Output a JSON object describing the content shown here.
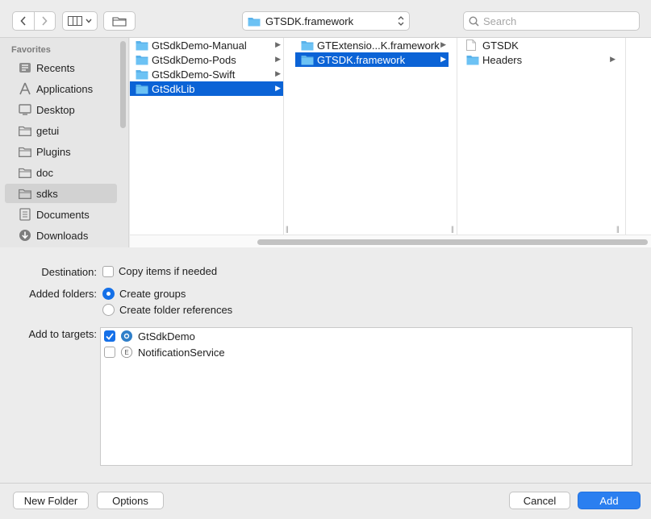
{
  "toolbar": {
    "path_label": "GTSDK.framework",
    "search_placeholder": "Search"
  },
  "sidebar": {
    "title": "Favorites",
    "items": [
      {
        "label": "Recents",
        "icon": "clock-icon"
      },
      {
        "label": "Applications",
        "icon": "applications-icon"
      },
      {
        "label": "Desktop",
        "icon": "desktop-icon"
      },
      {
        "label": "getui",
        "icon": "folder-icon"
      },
      {
        "label": "Plugins",
        "icon": "folder-icon"
      },
      {
        "label": "doc",
        "icon": "folder-icon"
      },
      {
        "label": "sdks",
        "icon": "folder-icon",
        "selected": true
      },
      {
        "label": "Documents",
        "icon": "documents-icon"
      },
      {
        "label": "Downloads",
        "icon": "downloads-icon"
      }
    ]
  },
  "columns": [
    {
      "items": [
        {
          "label": "GtSdkDemo-Manual",
          "type": "folder"
        },
        {
          "label": "GtSdkDemo-Pods",
          "type": "folder"
        },
        {
          "label": "GtSdkDemo-Swift",
          "type": "folder"
        },
        {
          "label": "GtSdkLib",
          "type": "folder",
          "selected": true
        }
      ]
    },
    {
      "items": [
        {
          "label": "GTExtensio...K.framework",
          "type": "folder"
        },
        {
          "label": "GTSDK.framework",
          "type": "folder",
          "selected": true
        }
      ]
    },
    {
      "items": [
        {
          "label": "GTSDK",
          "type": "file"
        },
        {
          "label": "Headers",
          "type": "folder"
        }
      ]
    }
  ],
  "options": {
    "destination_label": "Destination:",
    "copy_items_label": "Copy items if needed",
    "copy_items_checked": false,
    "added_folders_label": "Added folders:",
    "create_groups_label": "Create groups",
    "create_folder_refs_label": "Create folder references",
    "selected_folder_option": "Create groups",
    "add_to_targets_label": "Add to targets:",
    "targets": [
      {
        "label": "GtSdkDemo",
        "checked": true,
        "icon": "app-target-icon"
      },
      {
        "label": "NotificationService",
        "checked": false,
        "icon": "extension-target-icon"
      }
    ]
  },
  "footer": {
    "new_folder_label": "New Folder",
    "options_label": "Options",
    "cancel_label": "Cancel",
    "add_label": "Add"
  },
  "colors": {
    "accent": "#0b63d6",
    "folder": "#5ab2ea",
    "primary_button": "#2b7ff0"
  }
}
